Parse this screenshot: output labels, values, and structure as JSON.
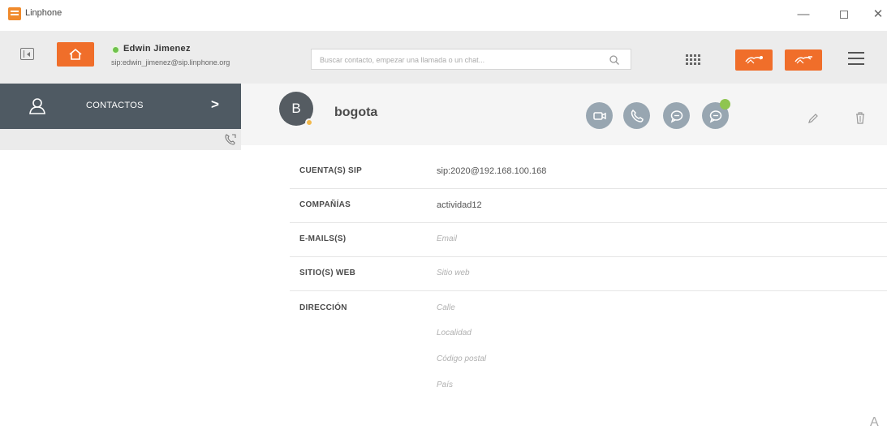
{
  "window": {
    "title": "Linphone",
    "minimize_icon": "minimize-icon",
    "maximize_icon": "maximize-icon",
    "close_icon": "close-icon"
  },
  "toolbar": {
    "user_name": "Edwin Jimenez",
    "user_sip": "sip:edwin_jimenez@sip.linphone.org",
    "search_placeholder": "Buscar contacto, empezar una llamada o un chat...",
    "accent_color": "#f06e2a"
  },
  "sidebar": {
    "contacts_label": "CONTACTOS",
    "chevron": ">",
    "active_bg": "#4f5a63"
  },
  "contact": {
    "initial": "B",
    "name": "bogota",
    "status_color": "#f2b84b"
  },
  "details": {
    "sip_label": "CUENTA(S) SIP",
    "sip_value": "sip:2020@192.168.100.168",
    "company_label": "COMPAÑÍAS",
    "company_value": "actividad12",
    "email_label": "E-MAILS(S)",
    "email_placeholder": "Email",
    "web_label": "SITIO(S) WEB",
    "web_placeholder": "Sitio web",
    "address_label": "DIRECCIÓN",
    "address_placeholders": [
      "Calle",
      "Localidad",
      "Código postal",
      "País"
    ]
  }
}
